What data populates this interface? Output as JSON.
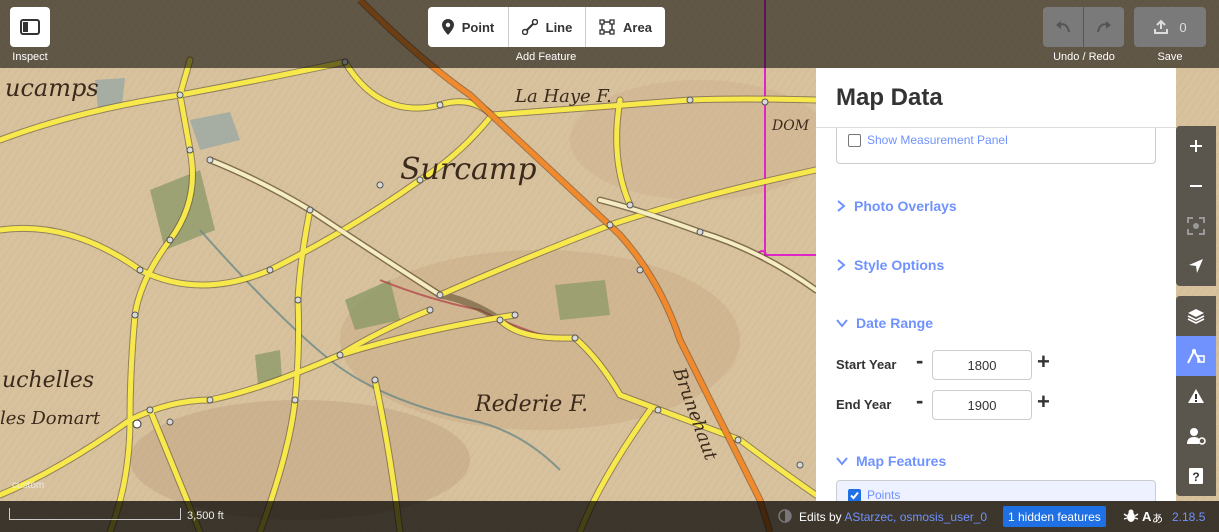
{
  "map": {
    "labels": {
      "surcamps_top": "ucamps",
      "la_haye": "La Haye F.",
      "surcamps": "Surcamp",
      "domart_right": "DOM",
      "uchelles": "uchelles",
      "domart_left": "les Domart",
      "rederie": "Rederie F.",
      "brunehaut": "Brunehaut"
    },
    "attribution": "custom"
  },
  "toolbar": {
    "inspect_label": "Inspect",
    "add_feature_label": "Add Feature",
    "point_label": "Point",
    "line_label": "Line",
    "area_label": "Area",
    "undo_redo_label": "Undo / Redo",
    "save_label": "Save",
    "save_count": "0"
  },
  "panel": {
    "title": "Map Data",
    "measurement_panel_label": "Show Measurement Panel",
    "sections": {
      "photo_overlays": "Photo Overlays",
      "style_options": "Style Options",
      "date_range": "Date Range",
      "map_features": "Map Features"
    },
    "date_range": {
      "start_label": "Start Year",
      "start_value": "1800",
      "end_label": "End Year",
      "end_value": "1900",
      "minus": "-",
      "plus": "+"
    },
    "map_features": {
      "points_label": "Points",
      "points_checked": true
    }
  },
  "footer": {
    "scale_label": "3,500 ft",
    "edits_by_prefix": "Edits by",
    "edits_by_users": "AStarzec, osmosis_user_0",
    "hidden_features": "1 hidden features",
    "version": "2.18.5"
  },
  "colors": {
    "accent": "#7092ff",
    "badge": "#1f6fe5",
    "road_yellow": "#f7e84b",
    "road_orange": "#f08a2c",
    "boundary_magenta": "#e024c8"
  }
}
